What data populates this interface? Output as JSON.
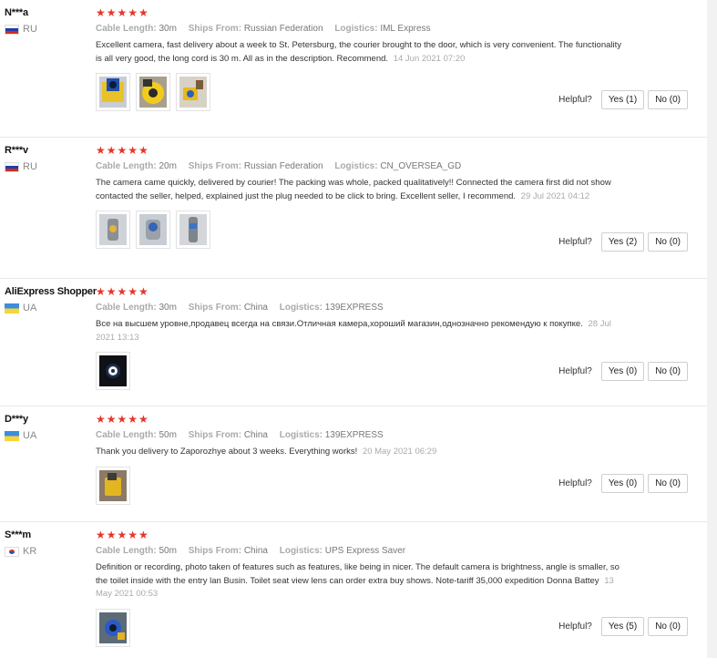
{
  "reviews": [
    {
      "user": "N***a",
      "country": "RU",
      "flag": "ru",
      "stars": "★★★★★",
      "cable_label": "Cable Length:",
      "cable": "30m",
      "ships_label": "Ships From:",
      "ships": "Russian Federation",
      "logistics_label": "Logistics:",
      "logistics": "IML Express",
      "text": "Excellent camera, fast delivery about a week to St. Petersburg, the courier brought to the door, which is very convenient. The functionality is all very good, the long cord is 30 m. All as in the description. Recommend.",
      "date": "14 Jun 2021 07:20",
      "helpful": "Helpful?",
      "yes": "Yes (1)",
      "no": "No (0)"
    },
    {
      "user": "R***v",
      "country": "RU",
      "flag": "ru",
      "stars": "★★★★★",
      "cable_label": "Cable Length:",
      "cable": "20m",
      "ships_label": "Ships From:",
      "ships": "Russian Federation",
      "logistics_label": "Logistics:",
      "logistics": "CN_OVERSEA_GD",
      "text": "The camera came quickly, delivered by courier! The packing was whole, packed qualitatively!! Connected the camera first did not show contacted the seller, helped, explained just the plug needed to be click to bring. Excellent seller, I recommend.",
      "date": "29 Jul 2021 04:12",
      "helpful": "Helpful?",
      "yes": "Yes (2)",
      "no": "No (0)"
    },
    {
      "user": "AliExpress Shopper",
      "country": "UA",
      "flag": "ua",
      "stars": "★★★★★",
      "cable_label": "Cable Length:",
      "cable": "30m",
      "ships_label": "Ships From:",
      "ships": "China",
      "logistics_label": "Logistics:",
      "logistics": "139EXPRESS",
      "text": "Все на высшем уровне,продавец всегда на связи.Отличная камера,хороший магазин,однозначно рекомендую к покупке.",
      "date": "28 Jul 2021 13:13",
      "helpful": "Helpful?",
      "yes": "Yes (0)",
      "no": "No (0)"
    },
    {
      "user": "D***y",
      "country": "UA",
      "flag": "ua",
      "stars": "★★★★★",
      "cable_label": "Cable Length:",
      "cable": "50m",
      "ships_label": "Ships From:",
      "ships": "China",
      "logistics_label": "Logistics:",
      "logistics": "139EXPRESS",
      "text": "Thank you delivery to Zaporozhye about 3 weeks. Everything works!",
      "date": "20 May 2021 06:29",
      "helpful": "Helpful?",
      "yes": "Yes (0)",
      "no": "No (0)"
    },
    {
      "user": "S***m",
      "country": "KR",
      "flag": "kr",
      "stars": "★★★★★",
      "cable_label": "Cable Length:",
      "cable": "50m",
      "ships_label": "Ships From:",
      "ships": "China",
      "logistics_label": "Logistics:",
      "logistics": "UPS Express Saver",
      "text": "Definition or recording, photo taken of features such as features, like being in nicer. The default camera is brightness, angle is smaller, so the toilet inside with the entry lan Busin. Toilet seat view lens can order extra buy shows. Note-tariff 35,000 expedition Donna Battey",
      "date": "13 May 2021 00:53",
      "helpful": "Helpful?",
      "yes": "Yes (5)",
      "no": "No (0)"
    }
  ],
  "colors": {
    "star": "#e5362a",
    "meta_label": "#aaaaaa",
    "border": "#e8e8e8"
  }
}
